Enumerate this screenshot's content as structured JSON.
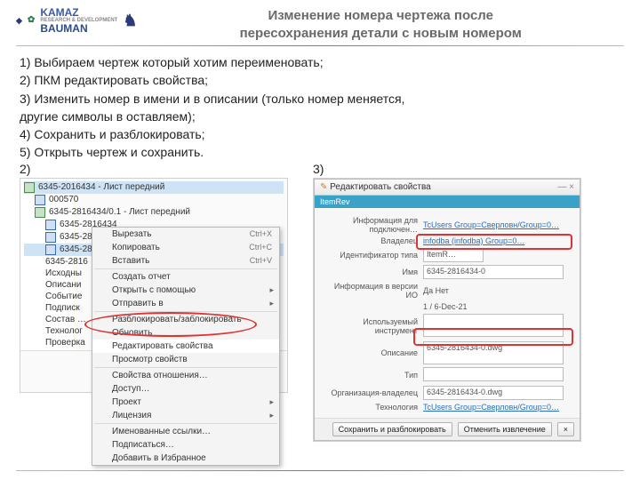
{
  "header": {
    "title_line1": "Изменение номера чертежа после",
    "title_line2": "пересохранения детали с новым номером",
    "logo_kamaz_top": "KAMAZ",
    "logo_kamaz_sub": "RESEARCH & DEVELOPMENT",
    "logo_bauman": "BAUMAN"
  },
  "steps": {
    "s1": "1) Выбираем чертеж который хотим переименовать;",
    "s2": "2) ПКМ редактировать свойства;",
    "s3a": "3) Изменить номер в имени и в описании (только номер меняется,",
    "s3b": "другие символы в оставляем);",
    "s4": "4) Сохранить и разблокировать;",
    "s5": "5) Открыть чертеж и сохранить."
  },
  "labels": {
    "l2": "2)",
    "l3": "3)"
  },
  "tree": {
    "r0": "6345-2016434 - Лист передний",
    "r1": "000570",
    "r2": "6345-2816434/0.1 - Лист передний",
    "r3": "6345-2816434",
    "r4": "6345-2816434-0",
    "r5": "6345-2816434-1",
    "r6": "6345-2816",
    "r7": "Исходны",
    "r8": "Описани",
    "r9": "Событие",
    "r10": "Подписк",
    "r11": "Состав …",
    "r12": "Технолог",
    "r13": "Проверка"
  },
  "ctx": {
    "cut": "Вырезать",
    "cut_sc": "Ctrl+X",
    "copy": "Копировать",
    "copy_sc": "Ctrl+C",
    "paste": "Вставить",
    "paste_sc": "Ctrl+V",
    "report": "Создать отчет",
    "openwith": "Открыть с помощью",
    "sendto": "Отправить в",
    "lock": "Разблокировать/заблокировать",
    "update": "Обновить",
    "editprops": "Редактировать свойства",
    "viewprops": "Просмотр свойств",
    "relprops": "Свойства отношения…",
    "access": "Доступ…",
    "project": "Проект",
    "license": "Лицензия",
    "namedrefs": "Именованные ссылки…",
    "sub": "Подписаться…",
    "fav": "Добавить в Избранное"
  },
  "dialog": {
    "title": "Редактировать свойства",
    "sub": "ItemRev",
    "f1": "Информация для подключен…",
    "f1v": "TcUsers  Group=Сверловн/Group=0…",
    "f2": "Владелец",
    "f2v": "infodba (infodba)   Group=0…",
    "f3": "Идентификатор типа",
    "f3v": "ItemR…",
    "f4": "Имя",
    "f4v": "6345-2816434-0",
    "f5": "Информация в версии ИО",
    "f5v": "Да   Нет",
    "f6": "",
    "f6v": "1 / 6-Dec-21",
    "f7": "Используемый инструмент",
    "f7v": "",
    "f8": "Описание",
    "f8v": "6345-2816434-0.dwg",
    "f9": "Тип",
    "f10": "Организация-владелец",
    "f10v": "6345-2816434-0.dwg",
    "f11": "Технология",
    "f11v": "TcUsers  Group=Сверловн/Group=0…",
    "btn_save": "Сохранить и разблокировать",
    "btn_cancel": "Отменить извлечение",
    "btn_close": "×"
  }
}
